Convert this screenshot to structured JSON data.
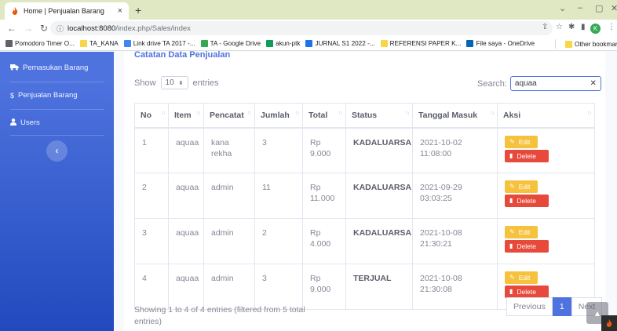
{
  "browser": {
    "tab_title": "Home | Penjualan Barang",
    "tab_close": "×",
    "new_tab": "+",
    "url_host": "localhost:8080",
    "url_path": "/index.php/Sales/index",
    "bookmarks": [
      {
        "label": "Pomodoro Timer O...",
        "color": "#5f6368"
      },
      {
        "label": "TA_KANA",
        "color": "#f9d648"
      },
      {
        "label": "Link drive TA 2017 -...",
        "color": "#4285f4"
      },
      {
        "label": "TA - Google Drive",
        "color": "#34a853"
      },
      {
        "label": "akun-ptk",
        "color": "#0f9d58"
      },
      {
        "label": "JURNAL S1 2022 -...",
        "color": "#1a73e8"
      },
      {
        "label": "REFERENSI PAPER K...",
        "color": "#f9d648"
      },
      {
        "label": "File saya - OneDrive",
        "color": "#0364b8"
      }
    ],
    "other_bookmarks": "Other bookmark",
    "profile_initial": "K"
  },
  "sidebar": {
    "items": [
      {
        "label": "Pemasukan Barang",
        "icon": "truck-icon"
      },
      {
        "label": "Penjualan Barang",
        "icon": "dollar-icon"
      },
      {
        "label": "Users",
        "icon": "user-icon"
      }
    ],
    "toggle_glyph": "‹"
  },
  "main": {
    "card_title": "Catatan Data Penjualan",
    "length_prefix": "Show",
    "length_value": "10",
    "length_suffix": "entries",
    "search_label": "Search:",
    "search_value": "aquaa",
    "columns": [
      "No",
      "Item",
      "Pencatat",
      "Jumlah",
      "Total",
      "Status",
      "Tanggal Masuk",
      "Aksi"
    ],
    "rows": [
      {
        "no": "1",
        "item": "aquaa",
        "pencatat": "kana rekha",
        "jumlah": "3",
        "total": "Rp 9.000",
        "status": "KADALUARSA",
        "tanggal": "2021-10-02 11:08:00"
      },
      {
        "no": "2",
        "item": "aquaa",
        "pencatat": "admin",
        "jumlah": "11",
        "total": "Rp 11.000",
        "status": "KADALUARSA",
        "tanggal": "2021-09-29 03:03:25"
      },
      {
        "no": "3",
        "item": "aquaa",
        "pencatat": "admin",
        "jumlah": "2",
        "total": "Rp 4.000",
        "status": "KADALUARSA",
        "tanggal": "2021-10-08 21:30:21"
      },
      {
        "no": "4",
        "item": "aquaa",
        "pencatat": "admin",
        "jumlah": "3",
        "total": "Rp 9.000",
        "status": "TERJUAL",
        "tanggal": "2021-10-08 21:30:08"
      }
    ],
    "edit_label": "Edit",
    "delete_label": "Delete",
    "info_text": "Showing 1 to 4 of 4 entries (filtered from 5 total entries)",
    "pagination": {
      "previous": "Previous",
      "current": "1",
      "next": "Next"
    }
  },
  "colors": {
    "primary": "#4e73df",
    "warning": "#f6c23e",
    "danger": "#e74a3b"
  }
}
